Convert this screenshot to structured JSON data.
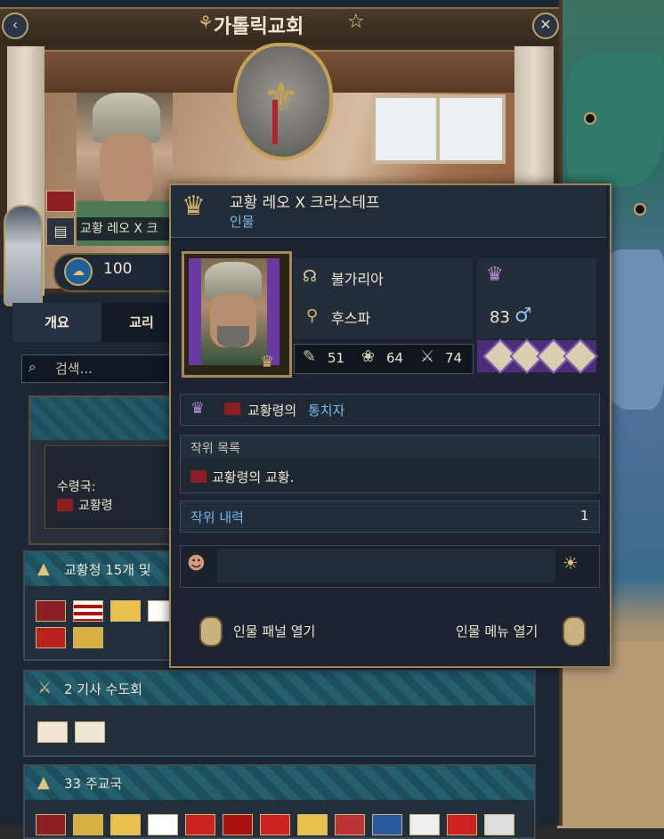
{
  "header": {
    "title": "가톨릭교회",
    "back_icon": "arrow-left-icon",
    "close_icon": "close-icon",
    "favorite_icon": "star-icon"
  },
  "faith_head": {
    "name_plate": "교황 레오 X 크",
    "piety": "100"
  },
  "tabs": [
    {
      "label": "개요",
      "selected": true
    },
    {
      "label": "교리",
      "selected": false
    }
  ],
  "search": {
    "placeholder": "검색..."
  },
  "holdings": {
    "suzerain_label": "수령국:",
    "suzerain_name": "교황령"
  },
  "sections": {
    "holy_orders_head": "교황청 15개 및 ",
    "knight_orders": "2 기사 수도회",
    "dioceses": "33 주교국"
  },
  "tooltip": {
    "title": "교황 레오 X 크라스테프",
    "subtitle": "인물",
    "culture": "불가리아",
    "faith": "후스파",
    "skills": [
      {
        "icon": "scroll-icon",
        "value": "51"
      },
      {
        "icon": "dove-icon",
        "value": "64"
      },
      {
        "icon": "crossed-swords-icon",
        "value": "74"
      }
    ],
    "age": "83",
    "gender_icon": "male-icon",
    "ruler_of_a": "교황령의",
    "ruler_of_b": "통치자",
    "titles_label": "작위 목록",
    "titles_item": "교황령의 교황.",
    "history_label": "작위 내력",
    "history_count": "1",
    "open_panel": "인물 패널 열기",
    "open_menu": "인물 메뉴 열기"
  },
  "colors": {
    "accent_blue": "#79b6e6",
    "frame_gold": "#a08556",
    "papal_red": "#8c1f24",
    "rank_purple": "#6b3aa0"
  }
}
